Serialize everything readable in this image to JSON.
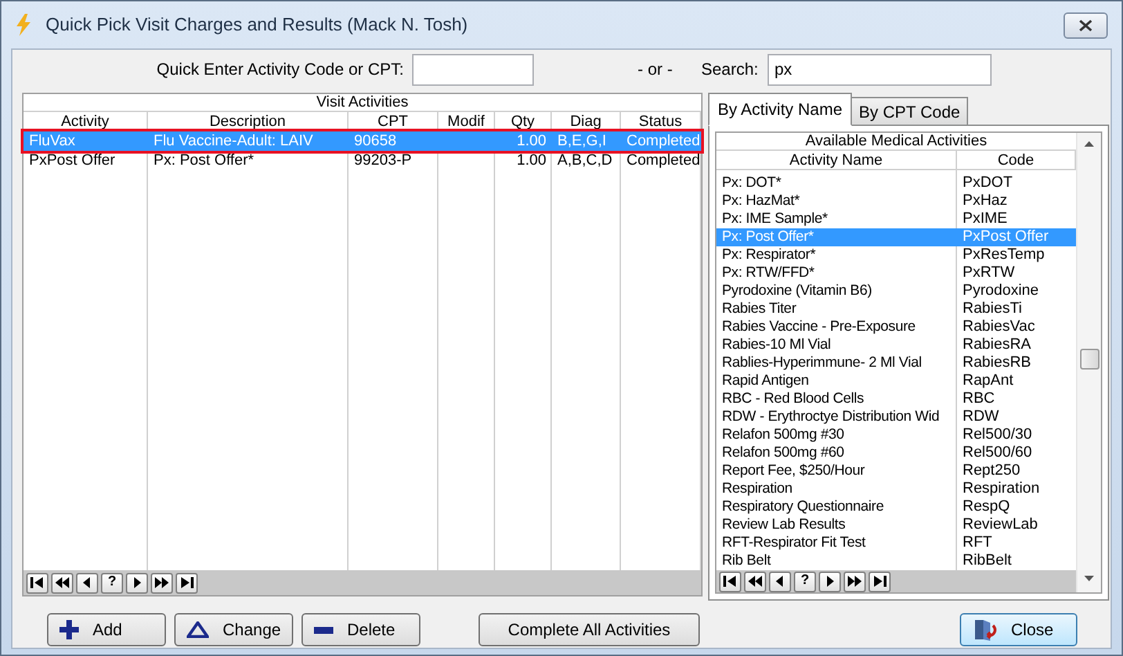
{
  "window": {
    "title": "Quick Pick Visit Charges and Results (Mack N. Tosh)"
  },
  "quick_enter": {
    "label": "Quick Enter Activity Code or CPT:"
  },
  "separator": "- or -",
  "search": {
    "label": "Search:",
    "value": "px"
  },
  "visit_activities": {
    "title": "Visit Activities",
    "columns": [
      "Activity",
      "Description",
      "CPT",
      "Modif",
      "Qty",
      "Diag",
      "Status"
    ],
    "rows": [
      {
        "cells": [
          "FluVax",
          "Flu Vaccine-Adult: LAIV",
          "90658",
          "",
          "1.00",
          "B,E,G,I",
          "Completed"
        ],
        "selected": true
      },
      {
        "cells": [
          "PxPost Offer",
          "Px: Post Offer*",
          "99203-P",
          "",
          "1.00",
          "A,B,C,D",
          "Completed"
        ],
        "selected": false
      }
    ],
    "nav": [
      {
        "kind": "first"
      },
      {
        "kind": "prev_page"
      },
      {
        "kind": "prev"
      },
      {
        "kind": "help",
        "label": "?"
      },
      {
        "kind": "next"
      },
      {
        "kind": "next_page"
      },
      {
        "kind": "last"
      }
    ]
  },
  "tabs": [
    {
      "label": "By Activity Name",
      "selected": true
    },
    {
      "label": "By CPT Code",
      "selected": false
    }
  ],
  "available_activities": {
    "title": "Available Medical Activities",
    "columns": [
      "Activity Name",
      "Code"
    ],
    "rows": [
      {
        "name": "Px: DOT*",
        "code": "PxDOT",
        "selected": false
      },
      {
        "name": "Px: HazMat*",
        "code": "PxHaz",
        "selected": false
      },
      {
        "name": "Px: IME Sample*",
        "code": "PxIME",
        "selected": false
      },
      {
        "name": "Px: Post Offer*",
        "code": "PxPost Offer",
        "selected": true
      },
      {
        "name": "Px: Respirator*",
        "code": "PxResTemp",
        "selected": false
      },
      {
        "name": "Px: RTW/FFD*",
        "code": "PxRTW",
        "selected": false
      },
      {
        "name": "Pyrodoxine (Vitamin B6)",
        "code": "Pyrodoxine",
        "selected": false
      },
      {
        "name": "Rabies Titer",
        "code": "RabiesTi",
        "selected": false
      },
      {
        "name": "Rabies Vaccine - Pre-Exposure",
        "code": "RabiesVac",
        "selected": false
      },
      {
        "name": "Rabies-10 Ml Vial",
        "code": "RabiesRA",
        "selected": false
      },
      {
        "name": "Rablies-Hyperimmune- 2 Ml Vial",
        "code": "RabiesRB",
        "selected": false
      },
      {
        "name": "Rapid Antigen",
        "code": "RapAnt",
        "selected": false
      },
      {
        "name": "RBC - Red Blood Cells",
        "code": "RBC",
        "selected": false
      },
      {
        "name": "RDW - Erythroctye Distribution Wid",
        "code": "RDW",
        "selected": false
      },
      {
        "name": "Relafon 500mg #30",
        "code": "Rel500/30",
        "selected": false
      },
      {
        "name": "Relafon 500mg #60",
        "code": "Rel500/60",
        "selected": false
      },
      {
        "name": "Report Fee, $250/Hour",
        "code": "Rept250",
        "selected": false
      },
      {
        "name": "Respiration",
        "code": "Respiration",
        "selected": false
      },
      {
        "name": "Respiratory Questionnaire",
        "code": "RespQ",
        "selected": false
      },
      {
        "name": "Review Lab Results",
        "code": "ReviewLab",
        "selected": false
      },
      {
        "name": "RFT-Respirator Fit Test",
        "code": "RFT",
        "selected": false
      },
      {
        "name": "Rib Belt",
        "code": "RibBelt",
        "selected": false
      }
    ],
    "nav": [
      {
        "kind": "first"
      },
      {
        "kind": "prev_page"
      },
      {
        "kind": "prev"
      },
      {
        "kind": "help",
        "label": "?"
      },
      {
        "kind": "next"
      },
      {
        "kind": "next_page"
      },
      {
        "kind": "last"
      }
    ]
  },
  "buttons": [
    {
      "kind": "add",
      "label": "Add"
    },
    {
      "kind": "change",
      "label": "Change"
    },
    {
      "kind": "delete",
      "label": "Delete"
    },
    {
      "kind": "complete",
      "label": "Complete All Activities"
    },
    {
      "kind": "close",
      "label": "Close"
    }
  ]
}
